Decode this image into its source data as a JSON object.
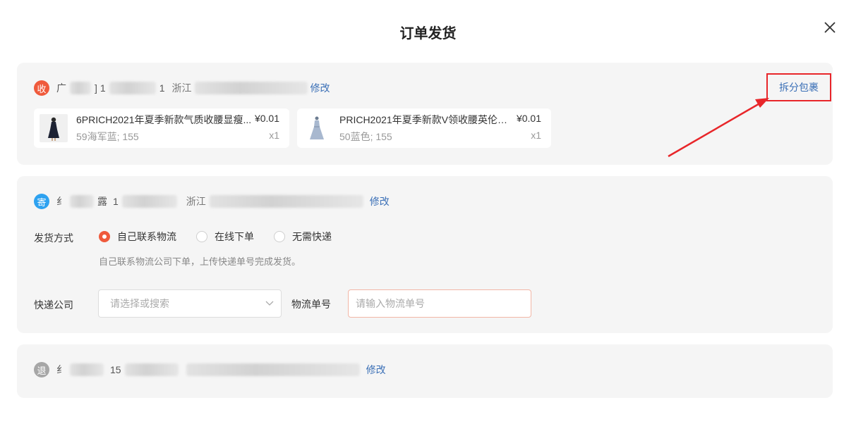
{
  "dialog": {
    "title": "订单发货"
  },
  "receiver": {
    "badge": "收",
    "name_fragment": "广",
    "name_tail": "]",
    "phone_head": "1",
    "phone_tail": "1",
    "addr_head": "浙江",
    "edit_label": "修改",
    "split_label": "拆分包裹"
  },
  "products": [
    {
      "name": "6PRICH2021年夏季新款气质收腰显瘦...",
      "price": "¥0.01",
      "spec": "59海军蓝; 155",
      "qty": "x1",
      "thumb": "product-thumb-dark-dress-icon"
    },
    {
      "name": "PRICH2021年夏季新款V领收腰英伦风...",
      "price": "¥0.01",
      "spec": "50蓝色; 155",
      "qty": "x1",
      "thumb": "product-thumb-blue-dress-icon"
    }
  ],
  "sender": {
    "badge": "寄",
    "name_fragment": "纟",
    "name_tail": "露",
    "phone_head": "1",
    "addr_head": "浙江",
    "edit_label": "修改"
  },
  "shipping": {
    "method_label": "发货方式",
    "options": [
      "自己联系物流",
      "在线下单",
      "无需快递"
    ],
    "selected_index": 0,
    "hint": "自己联系物流公司下单，上传快递单号完成发货。",
    "company_label": "快递公司",
    "company_placeholder": "请选择或搜索",
    "tracking_label": "物流单号",
    "tracking_placeholder": "请输入物流单号"
  },
  "return_addr": {
    "badge": "退",
    "name_fragment": "纟",
    "phone_head": "15",
    "edit_label": "修改"
  },
  "colors": {
    "accent": "#ef5a3c",
    "link": "#3a6fb6",
    "annotation": "#e8262a",
    "sender_badge": "#2ea2f0",
    "return_badge": "#a6a6a6"
  }
}
